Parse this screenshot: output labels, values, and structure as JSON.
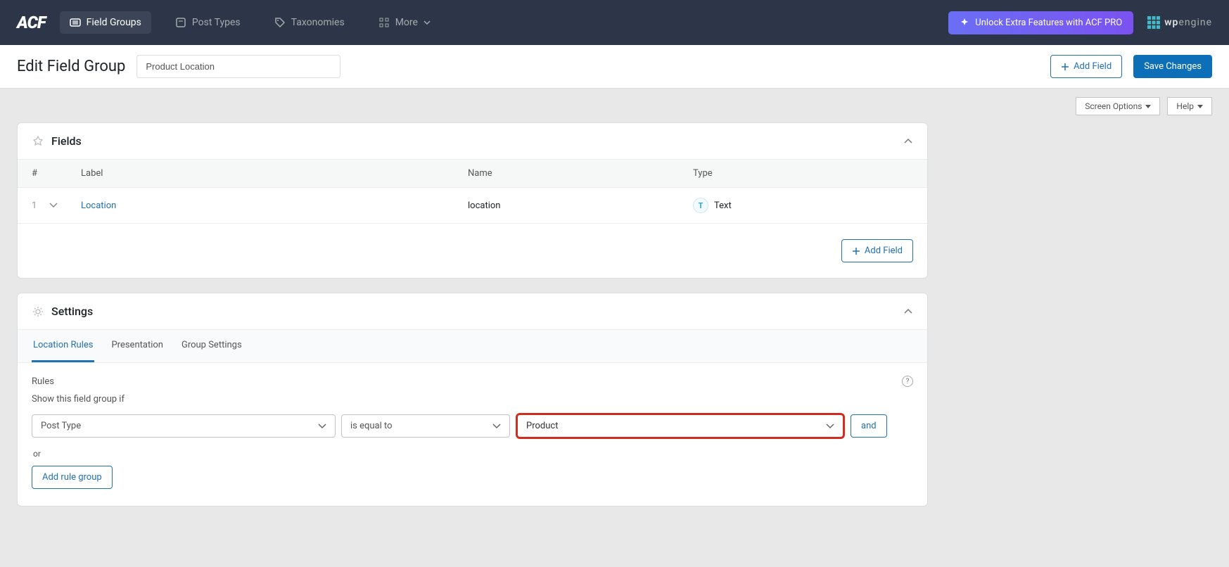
{
  "topbar": {
    "logo": "ACF",
    "nav": {
      "fieldGroups": "Field Groups",
      "postTypes": "Post Types",
      "taxonomies": "Taxonomies",
      "more": "More"
    },
    "unlock": "Unlock Extra Features with ACF PRO",
    "wpenginePrefix": "wp",
    "wpengineSuffix": "engine"
  },
  "header": {
    "title": "Edit Field Group",
    "inputValue": "Product Location",
    "addField": "Add Field",
    "saveChanges": "Save Changes"
  },
  "secondary": {
    "screenOptions": "Screen Options",
    "help": "Help"
  },
  "fieldsPanel": {
    "title": "Fields",
    "colNum": "#",
    "colLabel": "Label",
    "colName": "Name",
    "colType": "Type",
    "row": {
      "num": "1",
      "label": "Location",
      "name": "location",
      "typeLetter": "T",
      "type": "Text"
    },
    "addField": "Add Field"
  },
  "settingsPanel": {
    "title": "Settings",
    "tabs": {
      "location": "Location Rules",
      "presentation": "Presentation",
      "group": "Group Settings"
    },
    "rulesLabel": "Rules",
    "rulesSubtitle": "Show this field group if",
    "rule": {
      "param": "Post Type",
      "operator": "is equal to",
      "value": "Product",
      "and": "and"
    },
    "or": "or",
    "addRuleGroup": "Add rule group"
  }
}
